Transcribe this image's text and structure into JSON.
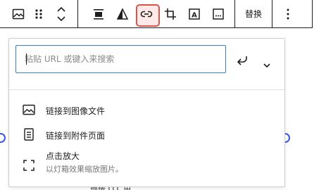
{
  "toolbar": {
    "replace_label": "替换",
    "buttons": [
      {
        "icon": "image-icon"
      },
      {
        "icon": "drag-handle-icon"
      },
      {
        "icon": "move-up-down-icon"
      },
      {
        "icon": "align-icon"
      },
      {
        "icon": "duotone-filter-icon"
      },
      {
        "icon": "link-icon",
        "active": true
      },
      {
        "icon": "crop-icon"
      },
      {
        "icon": "text-overlay-icon"
      },
      {
        "icon": "more-block-options-icon"
      }
    ],
    "active_highlight_color": "#d9534f",
    "more_icon": "more-vertical-icon"
  },
  "link_popover": {
    "search": {
      "placeholder": "粘贴 URL 或键入来搜索",
      "value": ""
    },
    "submit_icon": "enter-return-icon",
    "toggle_icon": "chevron-down-icon",
    "accent_color": "#3a7fc4",
    "items": [
      {
        "icon": "image-file-icon",
        "label": "链接到图像文件",
        "description": ""
      },
      {
        "icon": "page-icon",
        "label": "链接到附件页面",
        "description": ""
      },
      {
        "icon": "fullscreen-icon",
        "label": "点击放大",
        "description": "以灯箱效果缩放图片。"
      }
    ]
  },
  "background": {
    "caption_text": "链接 ccc 用"
  }
}
